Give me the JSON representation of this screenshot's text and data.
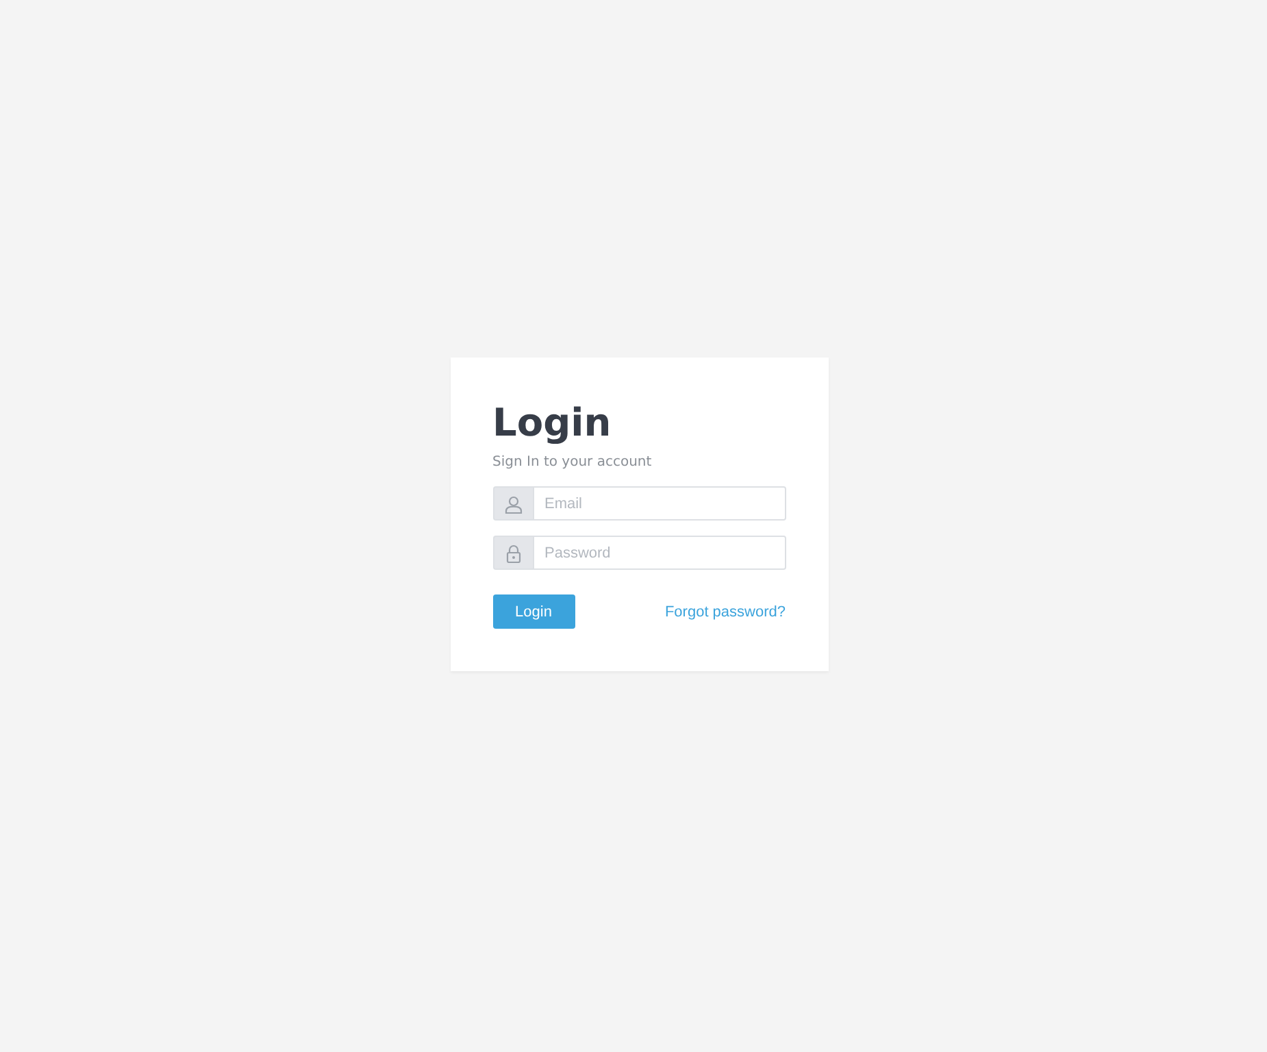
{
  "card": {
    "title": "Login",
    "subtitle": "Sign In to your account"
  },
  "fields": [
    {
      "kind": "user",
      "placeholder": "Email"
    },
    {
      "kind": "lock",
      "placeholder": "Password"
    }
  ],
  "login_button": "Login",
  "forgot_link": "Forgot password?"
}
